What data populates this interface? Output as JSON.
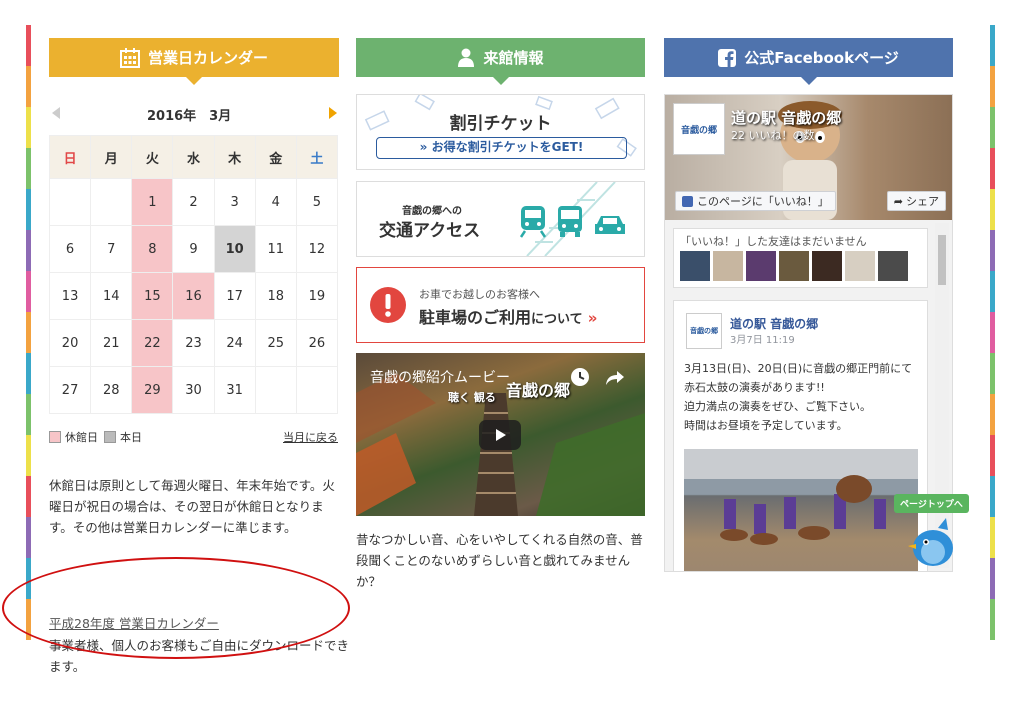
{
  "calendar_panel": {
    "header_title": "営業日カレンダー",
    "header_icon": "calendar-icon",
    "month_label": "2016年　3月",
    "weekdays": [
      "日",
      "月",
      "火",
      "水",
      "木",
      "金",
      "土"
    ],
    "weeks": [
      [
        "",
        "",
        "1",
        "2",
        "3",
        "4",
        "5"
      ],
      [
        "6",
        "7",
        "8",
        "9",
        "10",
        "11",
        "12"
      ],
      [
        "13",
        "14",
        "15",
        "16",
        "17",
        "18",
        "19"
      ],
      [
        "20",
        "21",
        "22",
        "23",
        "24",
        "25",
        "26"
      ],
      [
        "27",
        "28",
        "29",
        "30",
        "31",
        "",
        ""
      ]
    ],
    "closed_days": [
      "1",
      "8",
      "15",
      "16",
      "22",
      "29"
    ],
    "today": "10",
    "legend_closed": "休館日",
    "legend_today": "本日",
    "back_link": "当月に戻る",
    "note": "休館日は原則として毎週火曜日、年末年始です。火曜日が祝日の場合は、その翌日が休館日となります。その他は営業日カレンダーに準じます。",
    "download_link": "平成28年度 営業日カレンダー",
    "download_text": "事業者様、個人のお客様もご自由にダウンロードできます。"
  },
  "info_panel": {
    "header_title": "来館情報",
    "header_icon": "person-icon",
    "ticket_title": "割引チケット",
    "ticket_button": "» お得な割引チケットをGET!",
    "access_sub": "音戯の郷への",
    "access_title": "交通アクセス",
    "parking_sub": "お車でお越しのお客様へ",
    "parking_title": "駐車場のご利用",
    "parking_suffix": "について",
    "video_title": "音戯の郷紹介ムービー",
    "video_overlay": "音戯の郷",
    "video_overlay_sub": "聴く  観る",
    "description": "昔なつかしい音、心をいやしてくれる自然の音、普段聞くことのないめずらしい音と戯れてみませんか？"
  },
  "facebook_panel": {
    "header_title": "公式Facebookページ",
    "header_icon": "facebook-icon",
    "page_name": "道の駅 音戯の郷",
    "likes": "22 いいね！の数",
    "like_button": "このページに「いいね！」",
    "share_button": "シェア",
    "friends_text": "「いいね！」した友達はまだいません",
    "post_author": "道の駅 音戯の郷",
    "post_date": "3月7日 11:19",
    "post_text": "3月13日(日)、20日(日)に音戯の郷正門前にて赤石太鼓の演奏があります!!\n迫力満点の演奏をぜひ、ご覧下さい。\n時間はお昼頃を予定しています。",
    "logo_text": "音戯の郷",
    "page_top_label": "ページトップへ"
  },
  "colors": {
    "calendar_header": "#ebb12f",
    "info_header": "#6db26f",
    "facebook_header": "#4f73ad",
    "closed": "#f7c5c8",
    "today": "#d4d4d4",
    "alert_red": "#e2463f",
    "teal": "#2aaaa8",
    "circle": "#d01010"
  }
}
